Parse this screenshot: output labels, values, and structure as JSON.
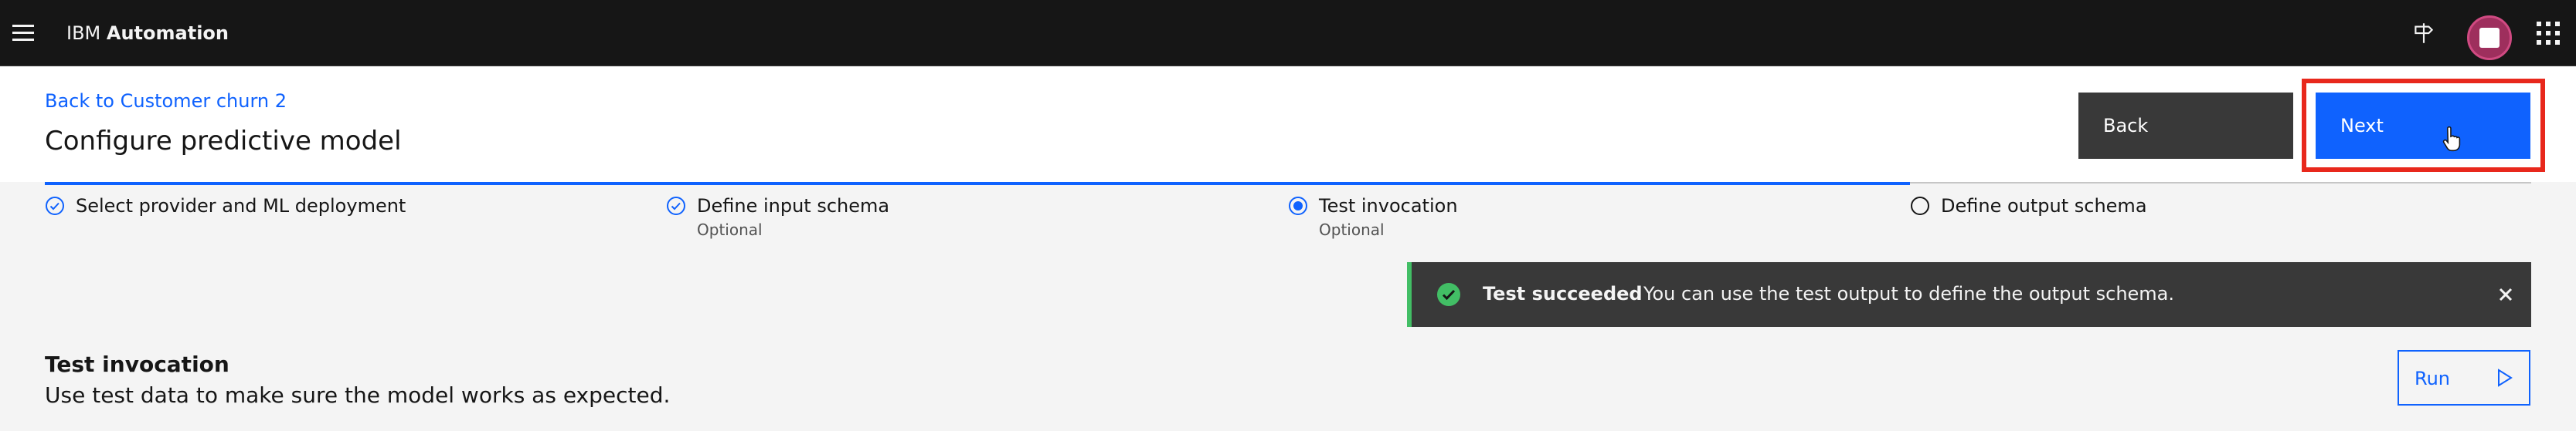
{
  "topbar": {
    "brand_prefix": "IBM",
    "brand_name": "Automation",
    "icons": [
      "menu-icon",
      "signpost-icon",
      "avatar",
      "app-switcher-icon"
    ]
  },
  "header": {
    "back_link": "Back to Customer churn 2",
    "title": "Configure predictive model",
    "back_button": "Back",
    "next_button": "Next"
  },
  "progress": {
    "steps": [
      {
        "label": "Select provider and ML deployment",
        "sub": "",
        "state": "complete"
      },
      {
        "label": "Define input schema",
        "sub": "Optional",
        "state": "complete"
      },
      {
        "label": "Test invocation",
        "sub": "Optional",
        "state": "current"
      },
      {
        "label": "Define output schema",
        "sub": "",
        "state": "incomplete"
      }
    ]
  },
  "notification": {
    "kind": "success",
    "title": "Test succeeded",
    "message": "You can use the test output to define the output schema."
  },
  "section": {
    "title": "Test invocation",
    "description": "Use test data to make sure the model works as expected.",
    "run_button": "Run"
  },
  "colors": {
    "primary": "#0f62fe",
    "topbar": "#161616",
    "success": "#42be65",
    "highlight": "#e8281c",
    "avatar": "#9e2f5d"
  }
}
